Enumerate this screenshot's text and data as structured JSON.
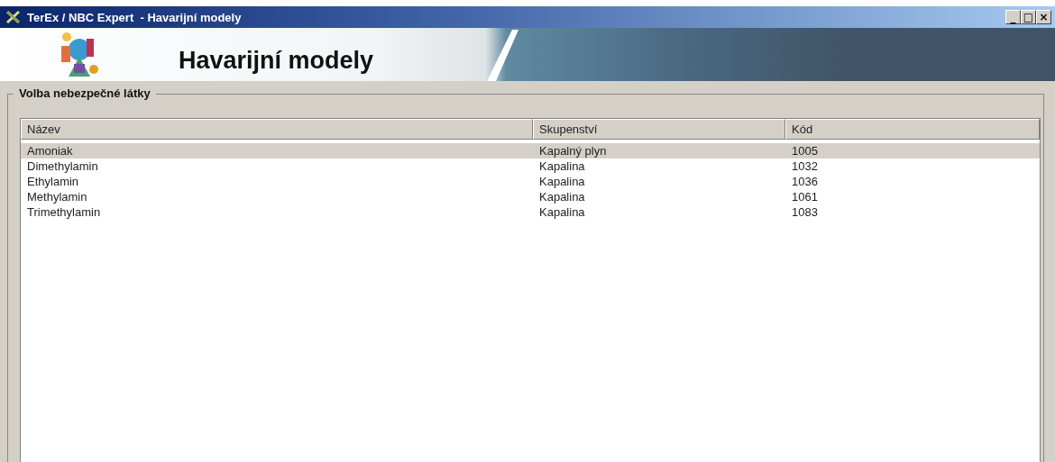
{
  "window": {
    "title": "TerEx / NBC Expert  - Havarijní modely",
    "controls": [
      "_",
      "□",
      "×"
    ]
  },
  "banner": {
    "title": "Havarijní modely"
  },
  "group": {
    "title": "Volba nebezpečné látky"
  },
  "table": {
    "columns": [
      "Název",
      "Skupenství",
      "Kód"
    ],
    "rows": [
      {
        "cells": [
          "Amoniak",
          "Kapalný plyn",
          "1005"
        ],
        "selected": true
      },
      {
        "cells": [
          "Dimethylamin",
          "Kapalina",
          "1032"
        ],
        "selected": false
      },
      {
        "cells": [
          "Ethylamin",
          "Kapalina",
          "1036"
        ],
        "selected": false
      },
      {
        "cells": [
          "Methylamin",
          "Kapalina",
          "1061"
        ],
        "selected": false
      },
      {
        "cells": [
          "Trimethylamin",
          "Kapalina",
          "1083"
        ],
        "selected": false
      }
    ]
  }
}
